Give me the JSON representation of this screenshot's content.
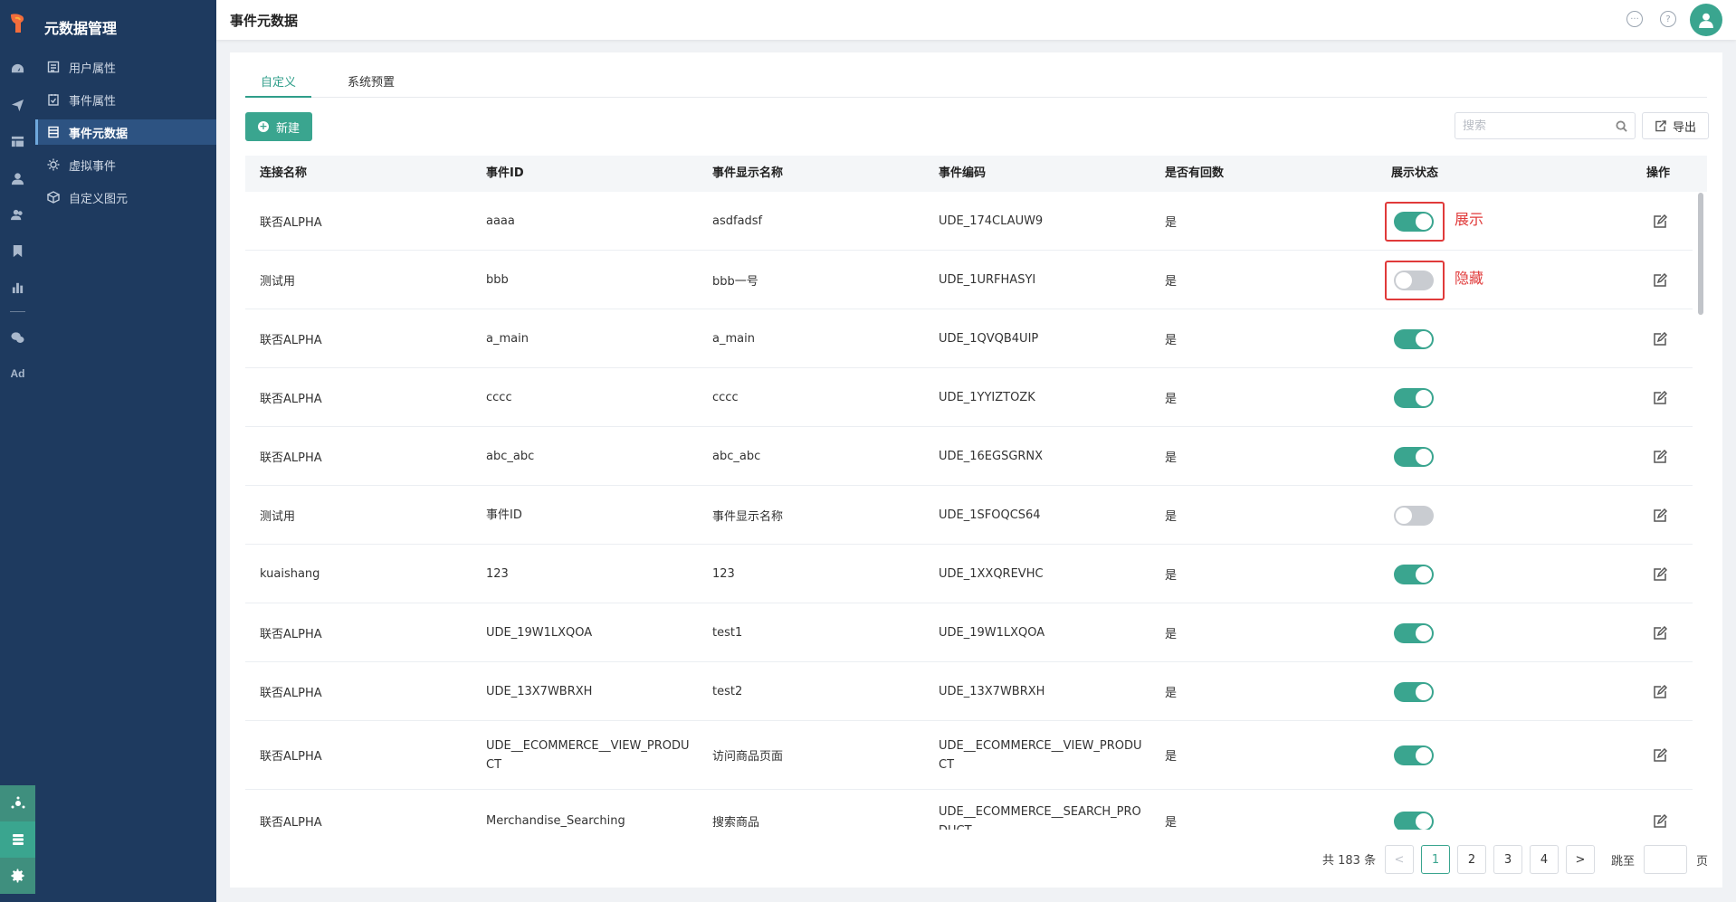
{
  "app": {
    "section_title": "元数据管理"
  },
  "header": {
    "title": "事件元数据"
  },
  "rail": {
    "icons": [
      "dashboard-icon",
      "send-icon",
      "panels-icon",
      "user-icon",
      "users-icon",
      "bookmark-icon",
      "bar-chart-icon",
      "wechat-icon"
    ],
    "ad_label": "Ad"
  },
  "menu": {
    "items": [
      {
        "label": "用户属性",
        "icon": "user-attr-icon"
      },
      {
        "label": "事件属性",
        "icon": "event-attr-icon"
      },
      {
        "label": "事件元数据",
        "icon": "event-meta-icon",
        "active": true
      },
      {
        "label": "虚拟事件",
        "icon": "virtual-event-icon"
      },
      {
        "label": "自定义图元",
        "icon": "custom-shape-icon"
      }
    ]
  },
  "tabs": [
    {
      "label": "自定义",
      "active": true
    },
    {
      "label": "系统预置",
      "active": false
    }
  ],
  "toolbar": {
    "new_label": "新建",
    "search_placeholder": "搜索",
    "export_label": "导出"
  },
  "table": {
    "columns": [
      "连接名称",
      "事件ID",
      "事件显示名称",
      "事件编码",
      "是否有回数",
      "展示状态",
      "操作"
    ],
    "rows": [
      {
        "conn": "联否ALPHA",
        "event_id": "aaaa",
        "display_name": "asdfadsf",
        "code": "UDE_174CLAUW9",
        "has_return": "是",
        "status_on": true
      },
      {
        "conn": "测试用",
        "event_id": "bbb",
        "display_name": "bbb一号",
        "code": "UDE_1URFHASYI",
        "has_return": "是",
        "status_on": false
      },
      {
        "conn": "联否ALPHA",
        "event_id": "a_main",
        "display_name": "a_main",
        "code": "UDE_1QVQB4UIP",
        "has_return": "是",
        "status_on": true
      },
      {
        "conn": "联否ALPHA",
        "event_id": "cccc",
        "display_name": "cccc",
        "code": "UDE_1YYIZTOZK",
        "has_return": "是",
        "status_on": true
      },
      {
        "conn": "联否ALPHA",
        "event_id": "abc_abc",
        "display_name": "abc_abc",
        "code": "UDE_16EGSGRNX",
        "has_return": "是",
        "status_on": true
      },
      {
        "conn": "测试用",
        "event_id": "事件ID",
        "display_name": "事件显示名称",
        "code": "UDE_1SFOQCS64",
        "has_return": "是",
        "status_on": false
      },
      {
        "conn": "kuaishang",
        "event_id": "123",
        "display_name": "123",
        "code": "UDE_1XXQREVHC",
        "has_return": "是",
        "status_on": true
      },
      {
        "conn": "联否ALPHA",
        "event_id": "UDE_19W1LXQOA",
        "display_name": "test1",
        "code": "UDE_19W1LXQOA",
        "has_return": "是",
        "status_on": true
      },
      {
        "conn": "联否ALPHA",
        "event_id": "UDE_13X7WBRXH",
        "display_name": "test2",
        "code": "UDE_13X7WBRXH",
        "has_return": "是",
        "status_on": true
      },
      {
        "conn": "联否ALPHA",
        "event_id": "UDE__ECOMMERCE__VIEW_PRODUCT",
        "display_name": "访问商品页面",
        "code": "UDE__ECOMMERCE__VIEW_PRODUCT",
        "has_return": "是",
        "status_on": true
      },
      {
        "conn": "联否ALPHA",
        "event_id": "Merchandise_Searching",
        "display_name": "搜索商品",
        "code": "UDE__ECOMMERCE__SEARCH_PRODUCT",
        "has_return": "是",
        "status_on": true
      }
    ]
  },
  "annotations": {
    "show_label": "展示",
    "hide_label": "隐藏"
  },
  "pagination": {
    "total_text": "共 183 条",
    "pages": [
      "1",
      "2",
      "3",
      "4"
    ],
    "current": "1",
    "prev": "<",
    "next": ">",
    "jump_label": "跳至",
    "page_suffix": "页"
  },
  "colors": {
    "primary": "#3aa58f",
    "sidebar": "#1e3a5f",
    "annotation": "#e03a3a"
  }
}
